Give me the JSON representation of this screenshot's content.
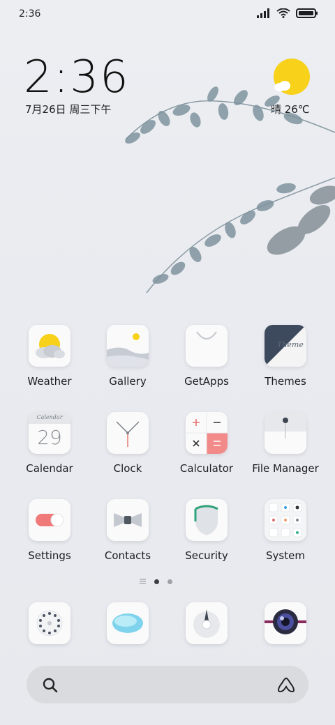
{
  "status": {
    "time": "2:36"
  },
  "widget": {
    "time": "2:36",
    "date": "7月26日 周三下午",
    "weather": "晴 26℃"
  },
  "apps": [
    {
      "label": "Weather"
    },
    {
      "label": "Gallery"
    },
    {
      "label": "GetApps"
    },
    {
      "label": "Themes"
    },
    {
      "label": "Calendar"
    },
    {
      "label": "Clock"
    },
    {
      "label": "Calculator"
    },
    {
      "label": "File Manager"
    },
    {
      "label": "Settings"
    },
    {
      "label": "Contacts"
    },
    {
      "label": "Security"
    },
    {
      "label": "System"
    }
  ],
  "icon_text": {
    "calendar_header": "Calendar",
    "calendar_day": "29",
    "themes_script": "Theme"
  },
  "colors": {
    "accent_red": "#f38a8a",
    "sun_yellow": "#f7d11a"
  }
}
